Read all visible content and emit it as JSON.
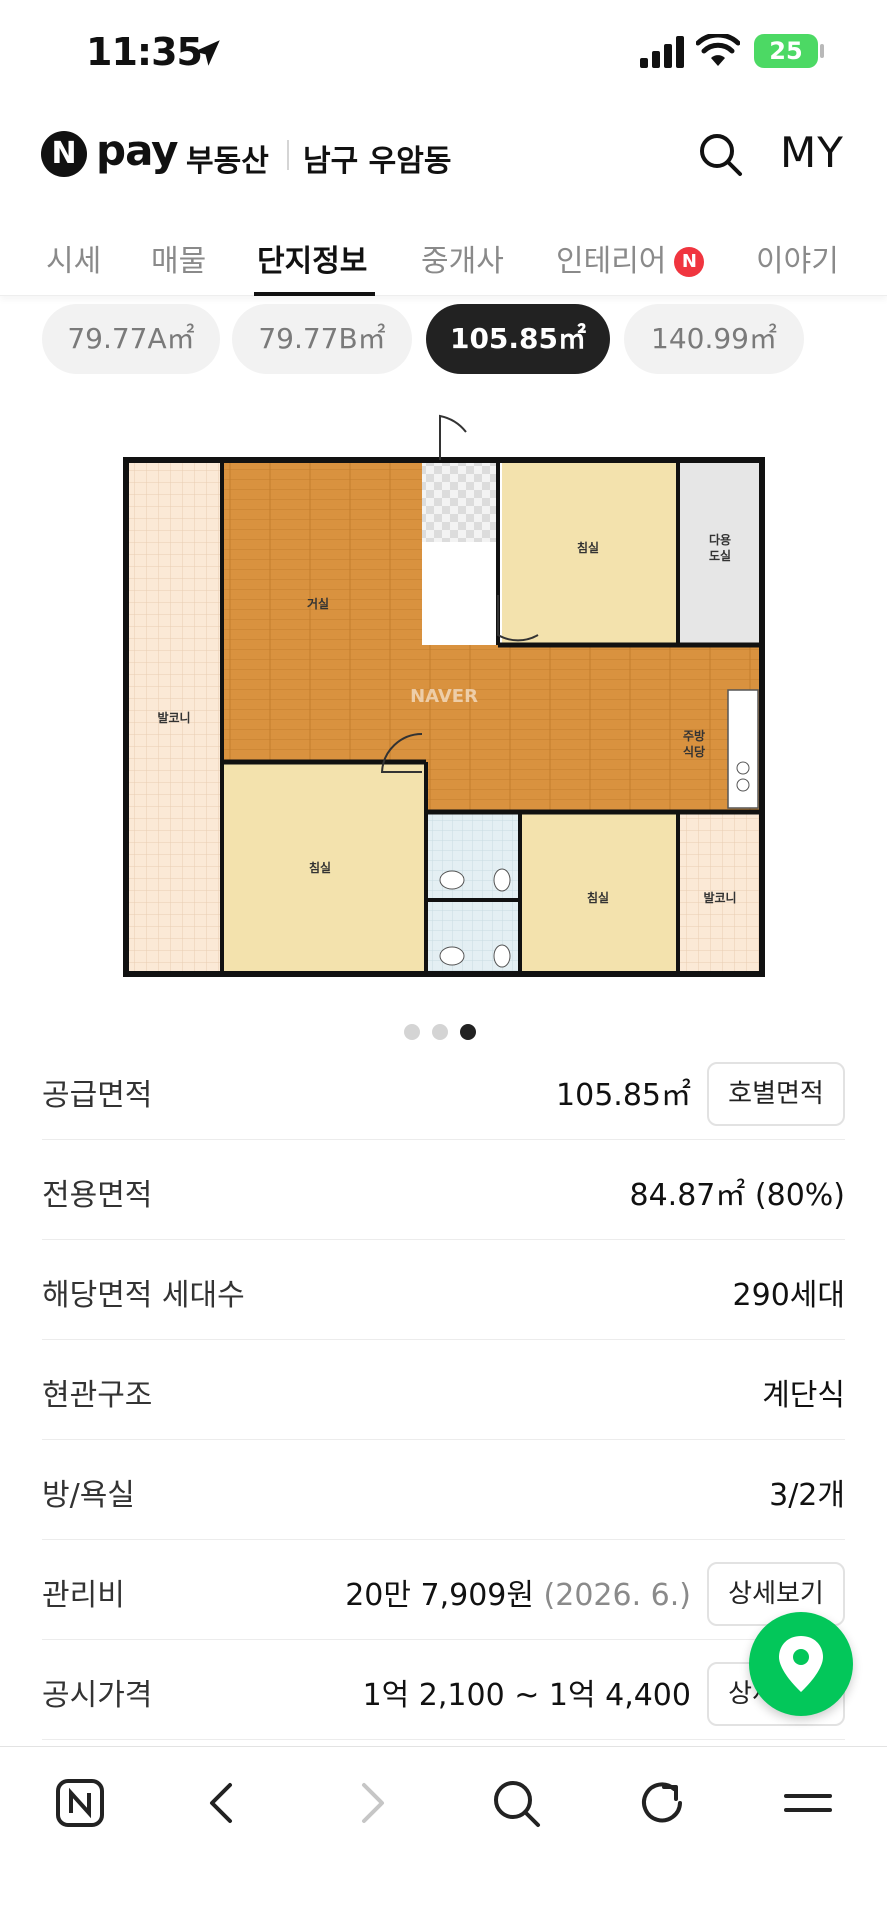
{
  "status_bar": {
    "time": "11:35",
    "battery": "25"
  },
  "header": {
    "logo_n": "N",
    "logo_pay": "pay",
    "logo_service": "부동산",
    "region": "남구 우암동",
    "my_label": "MY"
  },
  "tabs": [
    {
      "label": "시세",
      "active": false
    },
    {
      "label": "매물",
      "active": false
    },
    {
      "label": "단지정보",
      "active": true
    },
    {
      "label": "중개사",
      "active": false
    },
    {
      "label": "인테리어",
      "active": false,
      "badge": "N"
    },
    {
      "label": "이야기",
      "active": false
    }
  ],
  "size_chips": [
    {
      "label": "79.77A㎡",
      "active": false
    },
    {
      "label": "79.77B㎡",
      "active": false
    },
    {
      "label": "105.85㎡",
      "active": true
    },
    {
      "label": "140.99㎡",
      "active": false
    }
  ],
  "floor_plan": {
    "watermark": "NAVER",
    "rooms": {
      "balcony_left": "발코니",
      "living": "거실",
      "bedroom_top": "침실",
      "utility_line1": "다용",
      "utility_line2": "도실",
      "kitchen_line1": "주방",
      "kitchen_line2": "식당",
      "bedroom_bottom_left": "침실",
      "bedroom_bottom_right": "침실",
      "balcony_right": "발코니"
    }
  },
  "carousel": {
    "total": 3,
    "active_index": 2
  },
  "info_rows": [
    {
      "label": "공급면적",
      "value": "105.85㎡",
      "button": "호별면적"
    },
    {
      "label": "전용면적",
      "value": "84.87㎡ (80%)"
    },
    {
      "label": "해당면적 세대수",
      "value": "290세대"
    },
    {
      "label": "현관구조",
      "value": "계단식"
    },
    {
      "label": "방/욕실",
      "value": "3/2개"
    },
    {
      "label": "관리비",
      "value": "20만 7,909원",
      "value_sub": "(2026. 6.)",
      "button": "상세보기"
    },
    {
      "label": "공시가격",
      "value": "1억 2,100 ~ 1억 4,400",
      "button": "상세보기"
    }
  ],
  "colors": {
    "brand_green": "#03c75a",
    "badge_red": "#f0353f",
    "chip_active": "#222222",
    "battery_green": "#4cd964"
  },
  "icons": {
    "location": "location-arrow-icon",
    "signal": "cellular-signal-icon",
    "wifi": "wifi-icon",
    "battery": "battery-charging-icon",
    "search": "search-icon",
    "map_pin": "map-pin-icon",
    "bottom": [
      "naver-home-icon",
      "back-chevron-icon",
      "forward-chevron-icon",
      "search-icon",
      "refresh-icon",
      "menu-icon"
    ]
  }
}
